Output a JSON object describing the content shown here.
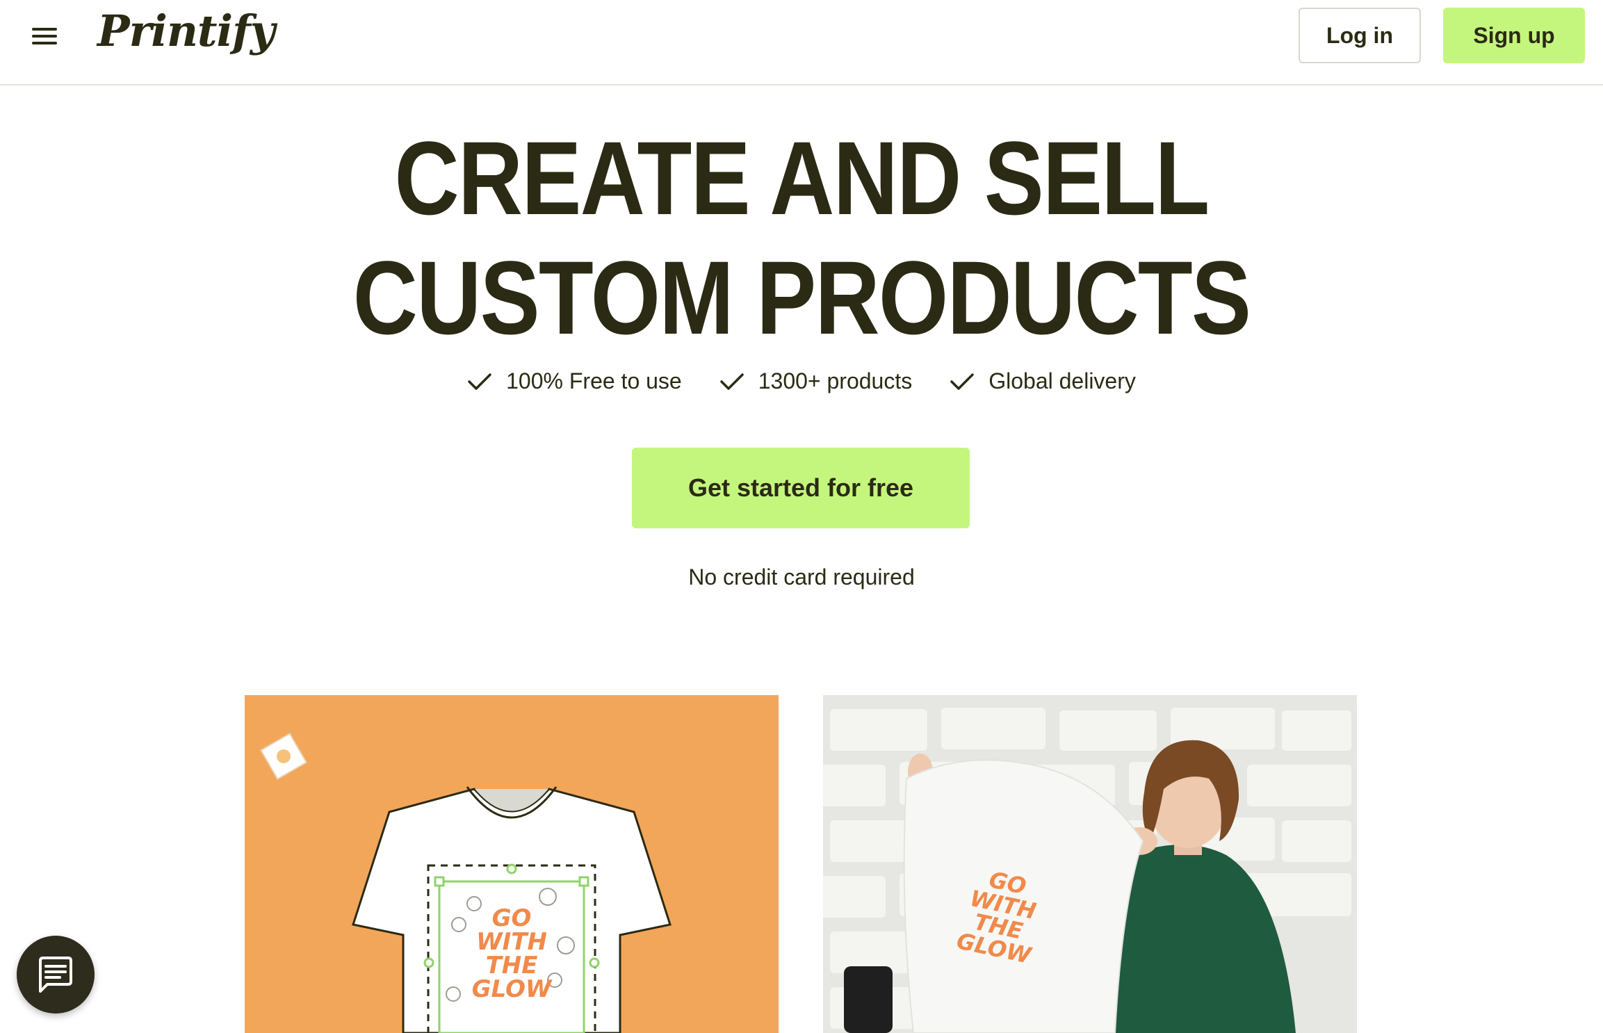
{
  "header": {
    "brand": "Printify",
    "login_label": "Log in",
    "signup_label": "Sign up"
  },
  "hero": {
    "title_line1": "CREATE AND SELL",
    "title_line2": "CUSTOM PRODUCTS",
    "features": [
      {
        "label": "100% Free to use"
      },
      {
        "label": "1300+ products"
      },
      {
        "label": "Global delivery"
      }
    ],
    "cta_label": "Get started for free",
    "note": "No credit card required"
  },
  "images": {
    "left_art_text": [
      "GO",
      "WITH",
      "THE",
      "GLOW"
    ],
    "right_art_text": [
      "GO",
      "WITH",
      "THE",
      "GLOW"
    ]
  },
  "colors": {
    "accent": "#c4f67e",
    "text": "#2b2a14",
    "orange": "#f2a65a",
    "print": "#f08a4b"
  },
  "icons": {
    "menu": "hamburger-icon",
    "check": "check-icon",
    "chat": "chat-icon"
  }
}
